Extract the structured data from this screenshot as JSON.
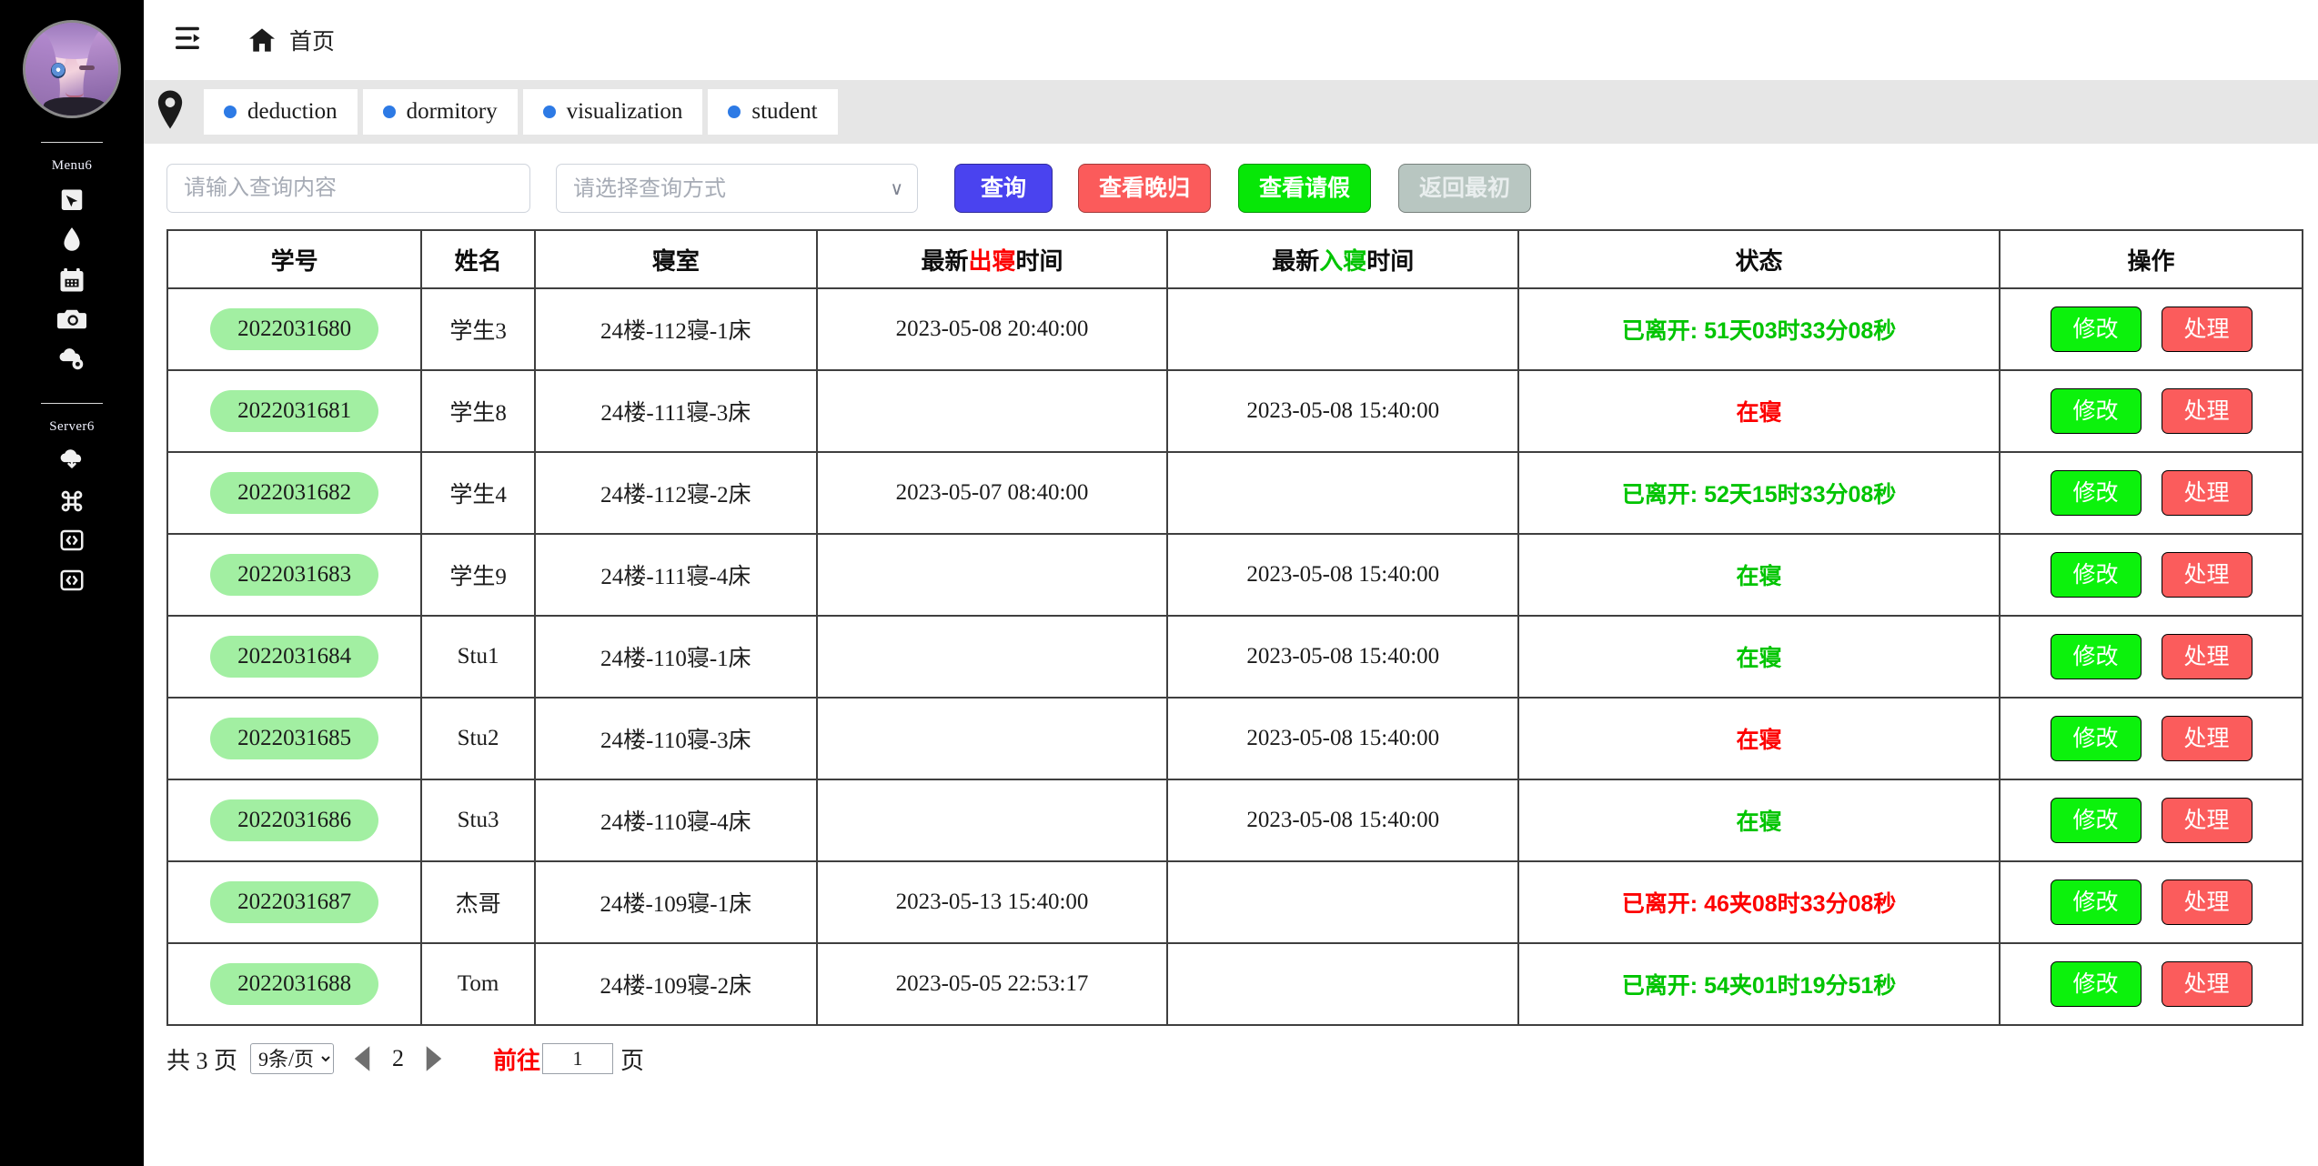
{
  "sidebar": {
    "avatar_name": "user-avatar",
    "group1_label": "Menu6",
    "group2_label": "Server6",
    "icons_group1": [
      {
        "name": "pointer-select-icon",
        "glyph": "⬚"
      },
      {
        "name": "water-drop-icon",
        "glyph": "💧"
      },
      {
        "name": "calendar-icon",
        "glyph": "🗓"
      },
      {
        "name": "camera-icon",
        "glyph": "📷"
      },
      {
        "name": "cloud-gear-icon",
        "glyph": "☁"
      }
    ],
    "icons_group2": [
      {
        "name": "cloud-download-icon",
        "glyph": "☁"
      },
      {
        "name": "command-icon",
        "glyph": "⌘"
      },
      {
        "name": "code-brackets-icon",
        "glyph": "⟨⟩"
      },
      {
        "name": "code-brackets-alt-icon",
        "glyph": "⟨⟩"
      }
    ]
  },
  "header": {
    "collapse_icon": "menu-collapse-icon",
    "home_icon": "home-icon",
    "breadcrumb": "首页"
  },
  "tagbar": {
    "pin_icon": "location-pin-icon",
    "tabs": [
      {
        "label": "deduction",
        "dot_color": "#2d7ae5"
      },
      {
        "label": "dormitory",
        "dot_color": "#2d7ae5"
      },
      {
        "label": "visualization",
        "dot_color": "#2d7ae5"
      },
      {
        "label": "student",
        "dot_color": "#2d7ae5"
      }
    ]
  },
  "toolbar": {
    "search_placeholder": "请输入查询内容",
    "search_value": "",
    "select_placeholder": "请选择查询方式",
    "select_caret": "∨",
    "buttons": {
      "query": "查询",
      "late_return": "查看晚归",
      "leave": "查看请假",
      "reset": "返回最初"
    },
    "colors": {
      "query": "#4a43ef",
      "late_return": "#fb5b5b",
      "leave": "#07e707",
      "reset": "#b8c6c1"
    }
  },
  "table": {
    "headers": [
      {
        "parts": [
          {
            "t": "学号",
            "c": "black"
          }
        ]
      },
      {
        "parts": [
          {
            "t": "姓名",
            "c": "black"
          }
        ]
      },
      {
        "parts": [
          {
            "t": "寝室",
            "c": "black"
          }
        ]
      },
      {
        "parts": [
          {
            "t": "最新",
            "c": "black"
          },
          {
            "t": "出寝",
            "c": "red"
          },
          {
            "t": "时间",
            "c": "black"
          }
        ]
      },
      {
        "parts": [
          {
            "t": "最新",
            "c": "black"
          },
          {
            "t": "入寝",
            "c": "green"
          },
          {
            "t": "时间",
            "c": "black"
          }
        ]
      },
      {
        "parts": [
          {
            "t": "状态",
            "c": "black"
          }
        ]
      },
      {
        "parts": [
          {
            "t": "操作",
            "c": "black"
          }
        ]
      }
    ],
    "op_labels": {
      "edit": "修改",
      "handle": "处理"
    },
    "rows": [
      {
        "sid": "2022031680",
        "name": "学生3",
        "room": "24楼-112寝-1床",
        "out_time": "2023-05-08 20:40:00",
        "in_time": "",
        "status": "已离开: 51天03时33分08秒",
        "status_color": "green"
      },
      {
        "sid": "2022031681",
        "name": "学生8",
        "room": "24楼-111寝-3床",
        "out_time": "",
        "in_time": "2023-05-08 15:40:00",
        "status": "在寝",
        "status_color": "red"
      },
      {
        "sid": "2022031682",
        "name": "学生4",
        "room": "24楼-112寝-2床",
        "out_time": "2023-05-07 08:40:00",
        "in_time": "",
        "status": "已离开: 52天15时33分08秒",
        "status_color": "green"
      },
      {
        "sid": "2022031683",
        "name": "学生9",
        "room": "24楼-111寝-4床",
        "out_time": "",
        "in_time": "2023-05-08 15:40:00",
        "status": "在寝",
        "status_color": "green"
      },
      {
        "sid": "2022031684",
        "name": "Stu1",
        "room": "24楼-110寝-1床",
        "out_time": "",
        "in_time": "2023-05-08 15:40:00",
        "status": "在寝",
        "status_color": "green"
      },
      {
        "sid": "2022031685",
        "name": "Stu2",
        "room": "24楼-110寝-3床",
        "out_time": "",
        "in_time": "2023-05-08 15:40:00",
        "status": "在寝",
        "status_color": "red"
      },
      {
        "sid": "2022031686",
        "name": "Stu3",
        "room": "24楼-110寝-4床",
        "out_time": "",
        "in_time": "2023-05-08 15:40:00",
        "status": "在寝",
        "status_color": "green"
      },
      {
        "sid": "2022031687",
        "name": "杰哥",
        "room": "24楼-109寝-1床",
        "out_time": "2023-05-13 15:40:00",
        "in_time": "",
        "status": "已离开: 46夹08时33分08秒",
        "status_color": "red"
      },
      {
        "sid": "2022031688",
        "name": "Tom",
        "room": "24楼-109寝-2床",
        "out_time": "2023-05-05 22:53:17",
        "in_time": "",
        "status": "已离开: 54夹01时19分51秒",
        "status_color": "green"
      }
    ]
  },
  "pagination": {
    "total_text": "共 3 页",
    "page_size": "9条/页",
    "page_size_options": [
      "9条/页"
    ],
    "current_page": "2",
    "goto_label": "前往",
    "goto_value": "1",
    "page_unit": "页"
  },
  "colors": {
    "sidebar_bg": "#000000",
    "tagbar_bg": "#e6e6e6",
    "accent_blue": "#2d7ae5",
    "status_green": "#00c400",
    "status_red": "#fd0000",
    "pill_green": "#a2efa2"
  }
}
